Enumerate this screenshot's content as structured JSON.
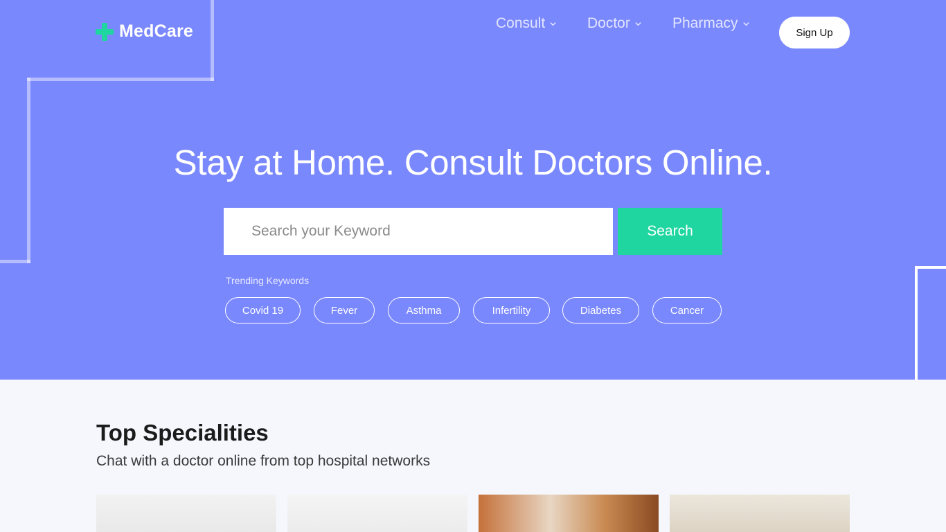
{
  "brand": {
    "name": "MedCare",
    "accent": "#20d6a0",
    "hero_bg": "#7a88fe"
  },
  "nav": {
    "items": [
      {
        "label": "Consult"
      },
      {
        "label": "Doctor"
      },
      {
        "label": "Pharmacy"
      }
    ],
    "signup_label": "Sign Up"
  },
  "hero": {
    "headline": "Stay at Home. Consult Doctors Online.",
    "search": {
      "placeholder": "Search your Keyword",
      "value": "",
      "button_label": "Search"
    },
    "trending_label": "Trending Keywords",
    "trending": [
      "Covid 19",
      "Fever",
      "Asthma",
      "Infertility",
      "Diabetes",
      "Cancer"
    ]
  },
  "specialities": {
    "title": "Top Specialities",
    "subtitle": "Chat with a doctor online from top hospital networks"
  }
}
